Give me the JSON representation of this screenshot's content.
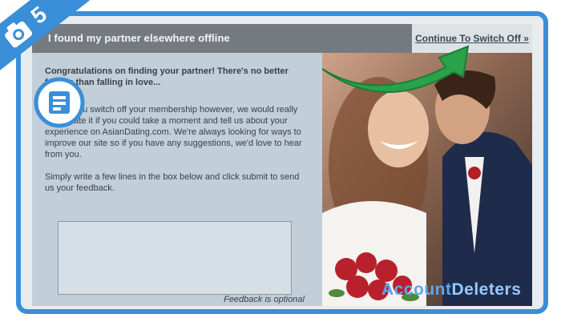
{
  "header": {
    "title": "I found my partner elsewhere offline",
    "continue_label": "Continue To Switch Off »"
  },
  "content": {
    "bold_line": "Congratulations on finding your partner! There's no better feeling than falling in love...",
    "paragraph_1": "Before you switch off your membership however, we would really appreciate it if you could take a moment and tell us about your experience on AsianDating.com. We're always looking for ways to improve our site so if you have any suggestions, we'd love to hear from you.",
    "paragraph_2": "Simply write a few lines in the box below and click submit to send us your feedback."
  },
  "feedback": {
    "value": "",
    "optional_note": "Feedback is optional"
  },
  "overlay": {
    "step_number": "5",
    "logo_part_1": "Account",
    "logo_part_2": "Deleters"
  },
  "colors": {
    "accent_blue": "#3a8fd8",
    "arrow_green": "#29a24a"
  }
}
